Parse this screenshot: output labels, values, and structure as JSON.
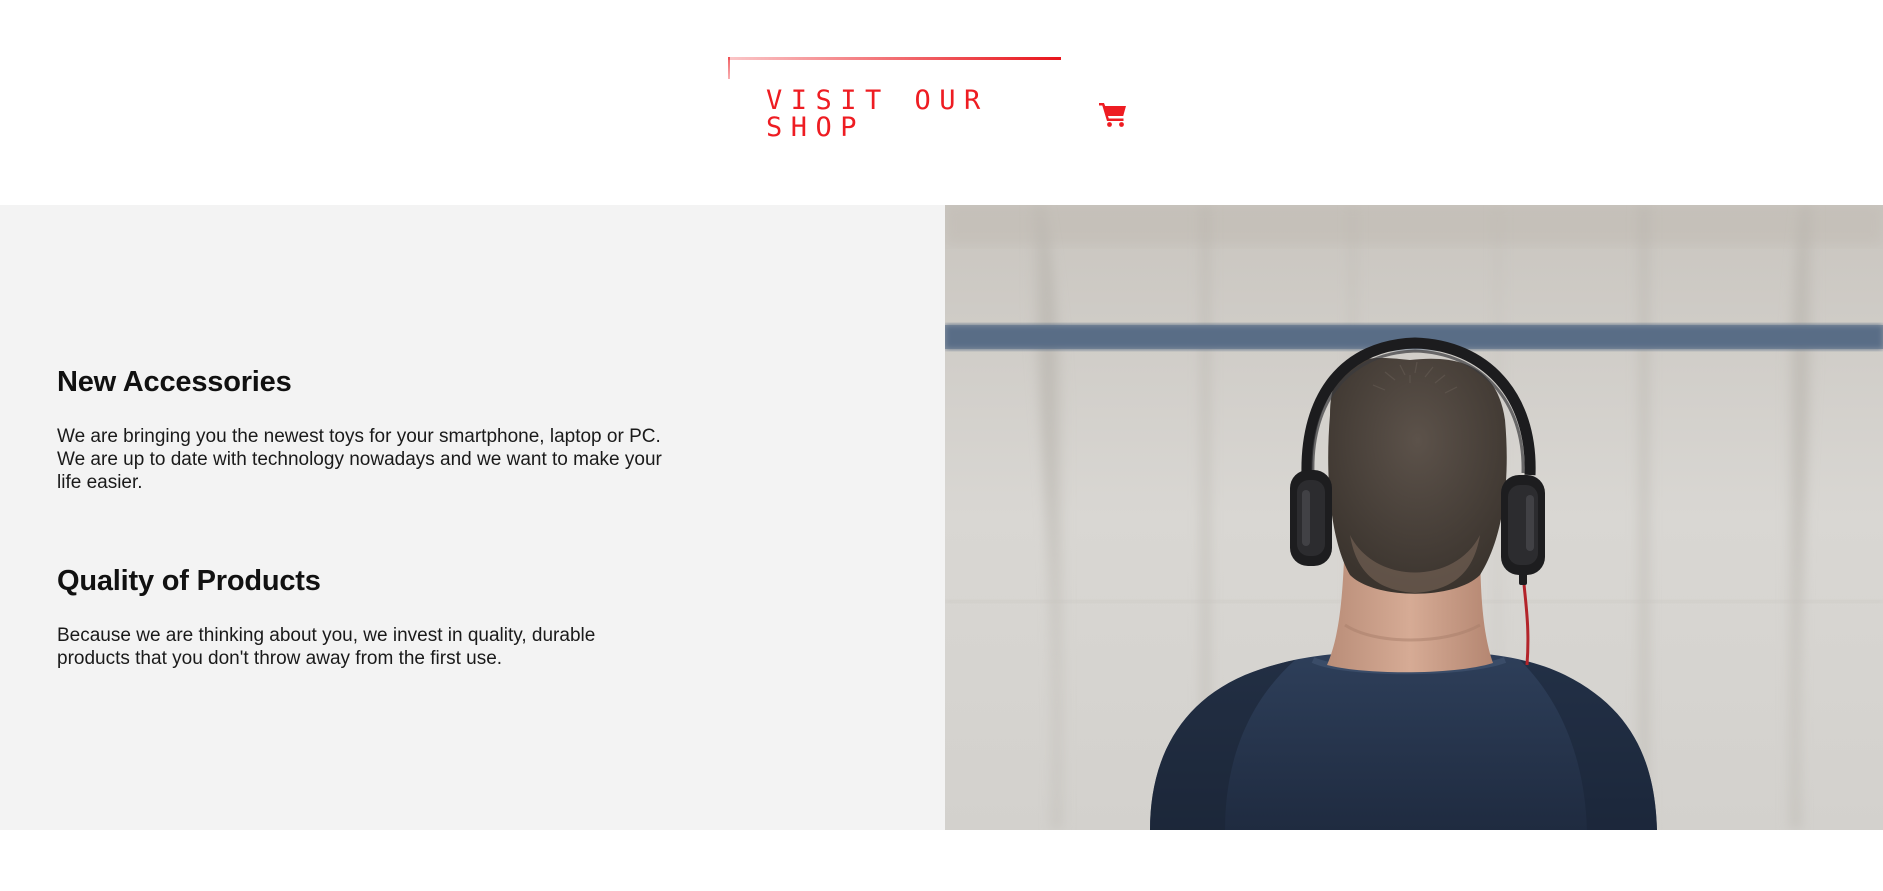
{
  "cta": {
    "label": "VISIT OUR SHOP",
    "icon": "shopping-cart-icon",
    "accent_color": "#ee1c22"
  },
  "features": [
    {
      "title": "New Accessories",
      "body": "We are bringing you the newest toys for your smartphone, laptop or PC. We are up to date with technology nowadays and we want to make your life easier."
    },
    {
      "title": "Quality of Products",
      "body": "Because we are thinking about you, we invest in quality, durable products that you don't throw away from the first use."
    }
  ],
  "colors": {
    "section_background": "#f3f3f3",
    "heading_text": "#111111"
  },
  "photo": {
    "subject": "person-with-headphones-photo"
  }
}
